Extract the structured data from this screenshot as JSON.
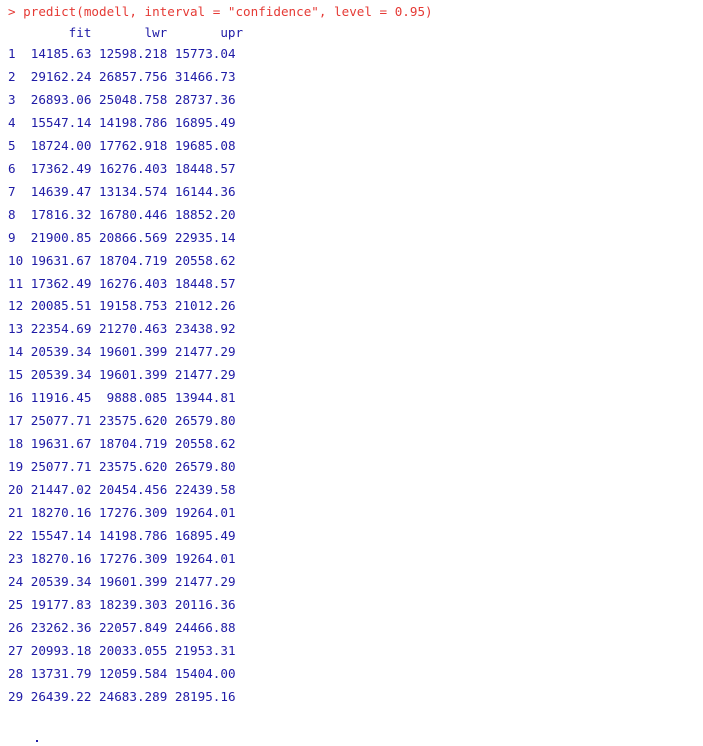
{
  "console": {
    "prompt": "> ",
    "command": "predict(modell, interval = \"confidence\", level = 0.95)",
    "columns": [
      "fit",
      "lwr",
      "upr"
    ],
    "rows": [
      {
        "id": "1",
        "fit": "14185.63",
        "lwr": "12598.218",
        "upr": "15773.04"
      },
      {
        "id": "2",
        "fit": "29162.24",
        "lwr": "26857.756",
        "upr": "31466.73"
      },
      {
        "id": "3",
        "fit": "26893.06",
        "lwr": "25048.758",
        "upr": "28737.36"
      },
      {
        "id": "4",
        "fit": "15547.14",
        "lwr": "14198.786",
        "upr": "16895.49"
      },
      {
        "id": "5",
        "fit": "18724.00",
        "lwr": "17762.918",
        "upr": "19685.08"
      },
      {
        "id": "6",
        "fit": "17362.49",
        "lwr": "16276.403",
        "upr": "18448.57"
      },
      {
        "id": "7",
        "fit": "14639.47",
        "lwr": "13134.574",
        "upr": "16144.36"
      },
      {
        "id": "8",
        "fit": "17816.32",
        "lwr": "16780.446",
        "upr": "18852.20"
      },
      {
        "id": "9",
        "fit": "21900.85",
        "lwr": "20866.569",
        "upr": "22935.14"
      },
      {
        "id": "10",
        "fit": "19631.67",
        "lwr": "18704.719",
        "upr": "20558.62"
      },
      {
        "id": "11",
        "fit": "17362.49",
        "lwr": "16276.403",
        "upr": "18448.57"
      },
      {
        "id": "12",
        "fit": "20085.51",
        "lwr": "19158.753",
        "upr": "21012.26"
      },
      {
        "id": "13",
        "fit": "22354.69",
        "lwr": "21270.463",
        "upr": "23438.92"
      },
      {
        "id": "14",
        "fit": "20539.34",
        "lwr": "19601.399",
        "upr": "21477.29"
      },
      {
        "id": "15",
        "fit": "20539.34",
        "lwr": "19601.399",
        "upr": "21477.29"
      },
      {
        "id": "16",
        "fit": "11916.45",
        "lwr": "9888.085",
        "upr": "13944.81"
      },
      {
        "id": "17",
        "fit": "25077.71",
        "lwr": "23575.620",
        "upr": "26579.80"
      },
      {
        "id": "18",
        "fit": "19631.67",
        "lwr": "18704.719",
        "upr": "20558.62"
      },
      {
        "id": "19",
        "fit": "25077.71",
        "lwr": "23575.620",
        "upr": "26579.80"
      },
      {
        "id": "20",
        "fit": "21447.02",
        "lwr": "20454.456",
        "upr": "22439.58"
      },
      {
        "id": "21",
        "fit": "18270.16",
        "lwr": "17276.309",
        "upr": "19264.01"
      },
      {
        "id": "22",
        "fit": "15547.14",
        "lwr": "14198.786",
        "upr": "16895.49"
      },
      {
        "id": "23",
        "fit": "18270.16",
        "lwr": "17276.309",
        "upr": "19264.01"
      },
      {
        "id": "24",
        "fit": "20539.34",
        "lwr": "19601.399",
        "upr": "21477.29"
      },
      {
        "id": "25",
        "fit": "19177.83",
        "lwr": "18239.303",
        "upr": "20116.36"
      },
      {
        "id": "26",
        "fit": "23262.36",
        "lwr": "22057.849",
        "upr": "24466.88"
      },
      {
        "id": "27",
        "fit": "20993.18",
        "lwr": "20033.055",
        "upr": "21953.31"
      },
      {
        "id": "28",
        "fit": "13731.79",
        "lwr": "12059.584",
        "upr": "15404.00"
      },
      {
        "id": "29",
        "fit": "26439.22",
        "lwr": "24683.289",
        "upr": "28195.16"
      }
    ]
  },
  "colors": {
    "command": "#e53a35",
    "output": "#1f1ba6",
    "background": "#ffffff"
  }
}
